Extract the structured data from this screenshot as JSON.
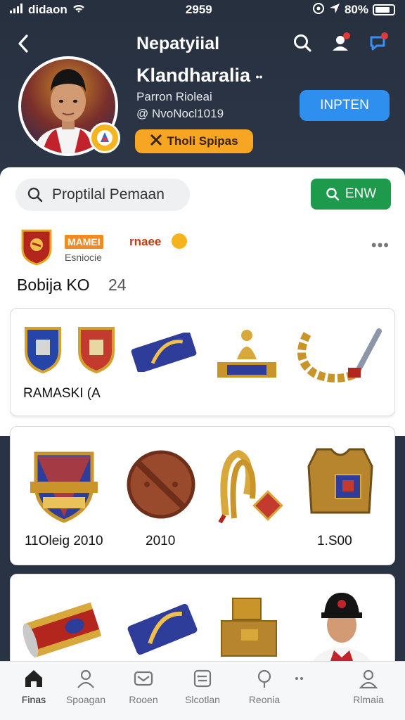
{
  "status": {
    "carrier": "didaon",
    "time": "2959",
    "battery": "80%"
  },
  "header": {
    "title": "Nepatyiial",
    "profile_name": "Klandharalia",
    "name_suffix": "••",
    "subtitle": "Parron Rioleai",
    "handle": "@ NvoNocl1019",
    "follow_label": "INPTEN",
    "rank_label": "Tholi Spipas"
  },
  "search": {
    "placeholder": "Proptilal Pemaan",
    "find_label": "ENW"
  },
  "post": {
    "tag": "MAMEI",
    "tag_extra": "rnaee",
    "meta": "Esniocie",
    "title": "Bobija KO",
    "count": "24"
  },
  "cards": {
    "card1_caption": "RAMASKI (A",
    "card2_captions": [
      "11Oleig 2010",
      "2010",
      "1.S00"
    ]
  },
  "nav": {
    "items": [
      {
        "label": "Finas",
        "icon": "home-icon"
      },
      {
        "label": "Spoagan",
        "icon": "person-icon"
      },
      {
        "label": "Rooen",
        "icon": "mail-icon"
      },
      {
        "label": "Slcotlan",
        "icon": "grid-icon"
      },
      {
        "label": "Reonia",
        "icon": "location-icon"
      },
      {
        "label": "Rlmaia",
        "icon": "profile-icon"
      }
    ]
  },
  "colors": {
    "header_bg": "#27303f",
    "follow": "#2e8fef",
    "find": "#1e9a4d",
    "rank": "#f6a623"
  }
}
